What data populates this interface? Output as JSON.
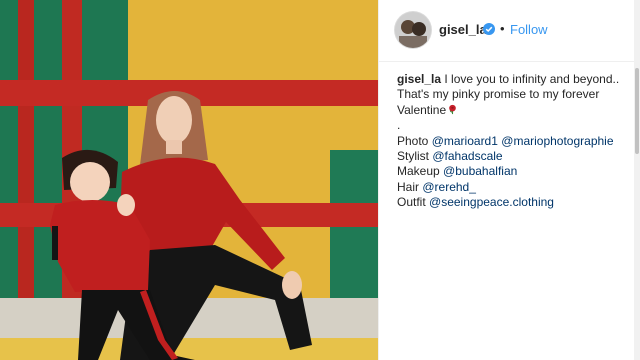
{
  "header": {
    "username": "gisel_la",
    "dot": "•",
    "follow_label": "Follow"
  },
  "caption": {
    "username": "gisel_la",
    "lines": [
      "I love you to infinity and beyond..",
      "That's my pinky promise to my forever",
      "Valentine",
      "."
    ],
    "credits": [
      {
        "role": "Photo",
        "handles": [
          "@marioard1",
          "@mariophotographie"
        ]
      },
      {
        "role": "Stylist",
        "handles": [
          "@fahadscale"
        ]
      },
      {
        "role": "Makeup",
        "handles": [
          "@bubahalfian"
        ]
      },
      {
        "role": "Hair",
        "handles": [
          "@rerehd_"
        ]
      },
      {
        "role": "Outfit",
        "handles": [
          "@seeingpeace.clothing"
        ]
      }
    ]
  },
  "icons": {
    "verified": "verified-badge-icon",
    "rose": "rose-emoji-icon"
  },
  "colors": {
    "accent": "#3897f0",
    "link": "#003569",
    "text": "#262626",
    "backdrop_yellow": "#e6b83e",
    "backdrop_red": "#c42a24",
    "backdrop_green": "#1f7a55"
  }
}
